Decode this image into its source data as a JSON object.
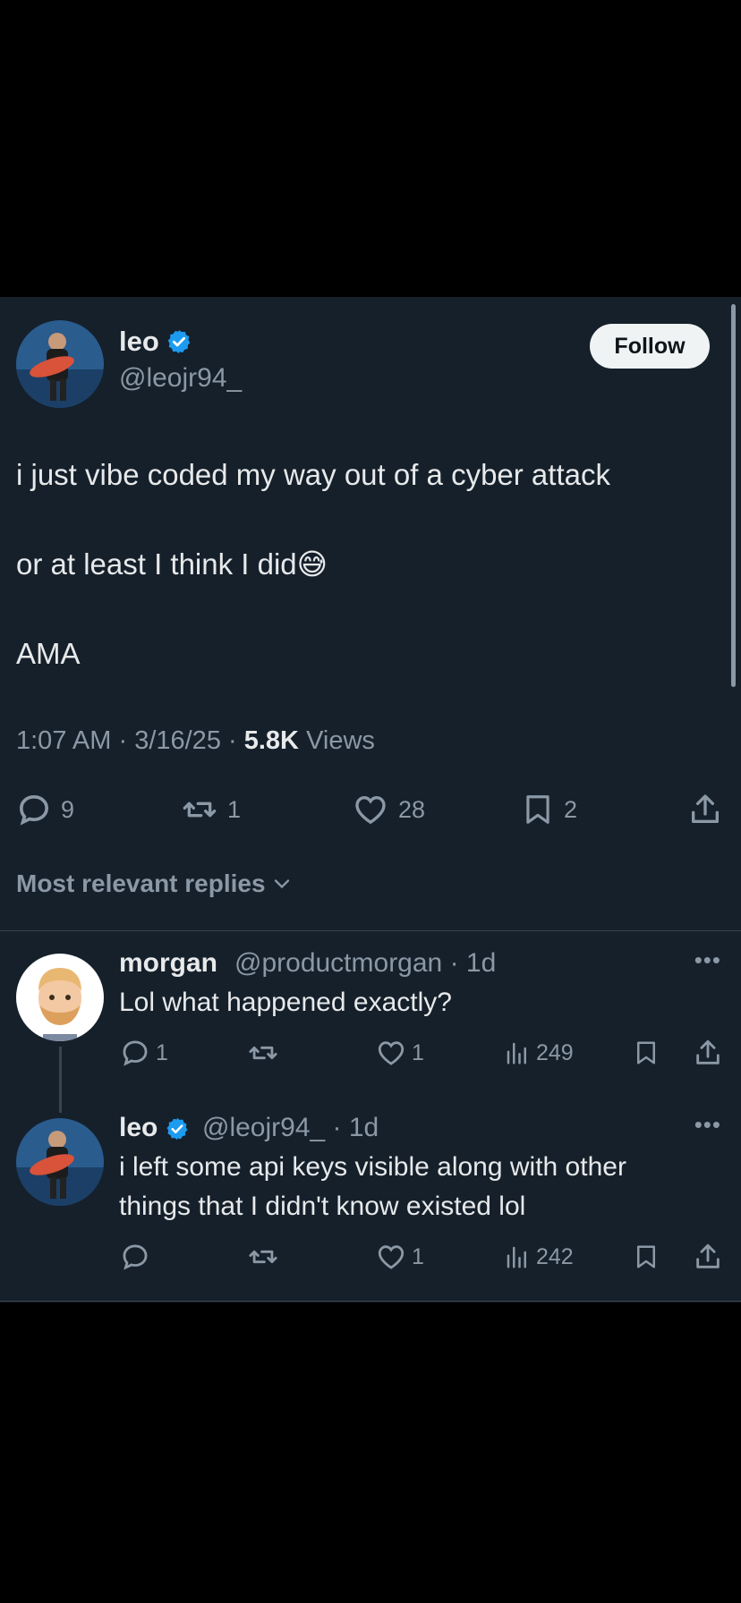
{
  "tweet": {
    "author_name": "leo",
    "author_handle": "@leojr94_",
    "follow_label": "Follow",
    "text_line1": "i just vibe coded my way out of a cyber attack",
    "text_line2": "or at least I think I did",
    "text_line2_emoji": "😅",
    "text_line3": "AMA",
    "time": "1:07 AM",
    "date": "3/16/25",
    "views_count": "5.8K",
    "views_label": "Views",
    "replies": "9",
    "reposts": "1",
    "likes": "28",
    "bookmarks": "2"
  },
  "sort_label": "Most relevant replies",
  "replies": [
    {
      "name": "morgan",
      "handle": "@productmorgan",
      "age": "1d",
      "text_lines": [
        "Lol what happened exactly?"
      ],
      "reply_count": "1",
      "repost_count": "",
      "like_count": "1",
      "views": "249"
    },
    {
      "name": "leo",
      "handle": "@leojr94_",
      "age": "1d",
      "text_lines": [
        "i left some api keys visible along with other",
        "things that I didn't know existed lol"
      ],
      "reply_count": "",
      "repost_count": "",
      "like_count": "1",
      "views": "242"
    }
  ],
  "colors": {
    "background": "#15202b",
    "text_primary": "#e7e9ea",
    "text_secondary": "#8b98a5",
    "verified_blue": "#1d9bf0",
    "divider": "#38444d"
  },
  "icons": [
    "verified-badge-icon",
    "reply-icon",
    "repost-icon",
    "like-icon",
    "bookmark-icon",
    "share-icon",
    "views-icon",
    "chevron-down-icon",
    "more-icon"
  ]
}
